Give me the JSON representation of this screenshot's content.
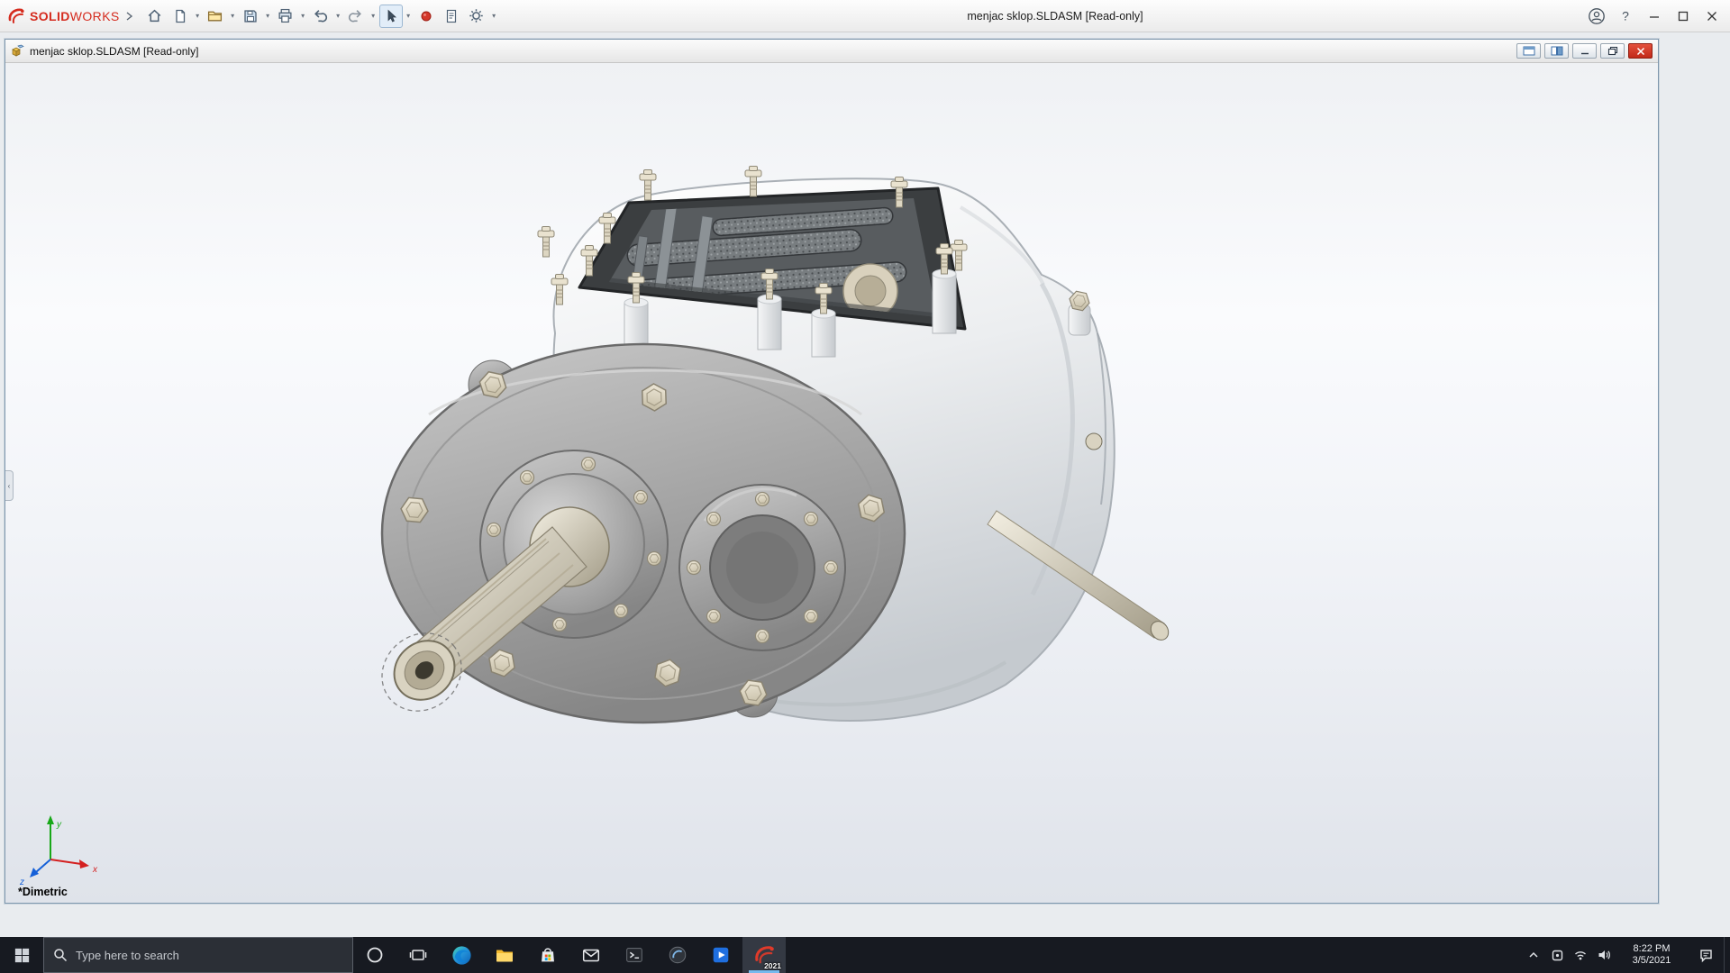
{
  "app": {
    "brand_solid": "SOLID",
    "brand_works": "WORKS",
    "title": "menjac sklop.SLDASM [Read-only]",
    "help_glyph": "?"
  },
  "toolbar": {
    "items": [
      {
        "name": "home",
        "dropdown": false
      },
      {
        "name": "new-file",
        "dropdown": true
      },
      {
        "name": "open-file",
        "dropdown": true
      },
      {
        "name": "save",
        "dropdown": true
      },
      {
        "name": "print",
        "dropdown": true
      },
      {
        "name": "undo",
        "dropdown": true
      },
      {
        "name": "redo",
        "dropdown": true
      },
      {
        "name": "select",
        "dropdown": true,
        "active": true
      },
      {
        "name": "rebuild",
        "dropdown": false
      },
      {
        "name": "file-properties",
        "dropdown": false
      },
      {
        "name": "options",
        "dropdown": true
      }
    ]
  },
  "document": {
    "title": "menjac sklop.SLDASM [Read-only]",
    "view_orientation": "*Dimetric",
    "triad": {
      "x": "x",
      "y": "y",
      "z": "z"
    }
  },
  "taskbar": {
    "search_placeholder": "Type here to search",
    "solidworks_badge": "2021",
    "clock": {
      "time": "8:22 PM",
      "date": "3/5/2021"
    }
  },
  "icons": {
    "solidworks-logo-icon": "red DS mark",
    "home-icon": "house",
    "new-file-icon": "blank sheet",
    "open-file-icon": "folder",
    "save-icon": "floppy disk",
    "print-icon": "printer",
    "undo-icon": "curved arrow left",
    "redo-icon": "curved arrow right",
    "select-cursor-icon": "pointer arrow",
    "rebuild-icon": "red dot",
    "file-properties-icon": "sheet with lines",
    "options-gear-icon": "gear",
    "user-account-icon": "person in circle",
    "help-icon": "question mark",
    "minimize-icon": "dash",
    "maximize-icon": "square",
    "close-icon": "x",
    "assembly-doc-icon": "yellow cubes",
    "tile-window-icon": "window panes",
    "windows-start-icon": "four squares",
    "search-icon": "magnifier",
    "cortana-icon": "ring",
    "task-view-icon": "stacked frames",
    "edge-icon": "blue swirl circle",
    "file-explorer-icon": "yellow folder",
    "store-icon": "shopping bag with flag",
    "mail-icon": "envelope",
    "terminal-app-icon": "dark console",
    "round-app-icon": "dark circle swirl",
    "media-app-icon": "blue tile play",
    "solidworks-app-icon": "red arcs",
    "chevron-up-icon": "caret",
    "tray-app-icon": "small square",
    "network-icon": "wifi arcs",
    "volume-icon": "speaker",
    "action-center-icon": "note bubble",
    "feature-tree-collapse-icon": "small chevron"
  },
  "colors": {
    "brand_red": "#d52b1e",
    "close_red": "#c22818",
    "taskbar_bg": "#171a21",
    "active_underline": "#76b9ed",
    "viewport_top": "#eff1f4",
    "viewport_bottom": "#dfe3ea"
  }
}
